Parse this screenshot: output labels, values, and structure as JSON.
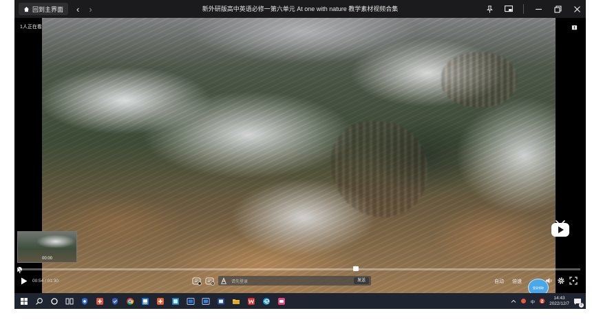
{
  "window": {
    "home_label": "回到主界面",
    "back_glyph": "‹",
    "forward_glyph": "›",
    "title": "新外研版高中英语必修一第六单元 At one with nature 教学素材视频合集"
  },
  "overlay": {
    "viewers_text": "1人正在看",
    "thumbnail_time": "00:00"
  },
  "player": {
    "progress_fraction": 0.004,
    "time_current": "00:54",
    "time_separator": " / ",
    "time_total": "01:30",
    "danmu_placeholder": "请先登录",
    "danmu_hint": "",
    "danmu_send": "发送",
    "auto_label": "自动",
    "speed_label": "倍速",
    "avatar_caption": "登录领取"
  },
  "taskbar": {
    "time": "14:43",
    "date": "2022/12/7",
    "ime": "中",
    "notification_count": "2"
  },
  "colors": {
    "accent": "#ef5d83",
    "titlebar": "#1b1b1d",
    "taskbar": "#1e2430"
  }
}
